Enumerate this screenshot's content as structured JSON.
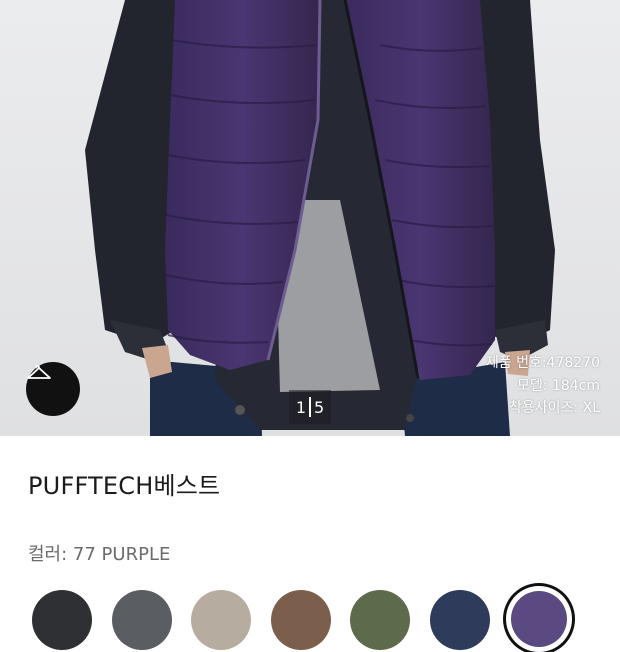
{
  "gallery": {
    "current_page": "1",
    "total_pages": "5",
    "model_info": {
      "product_no_label": "제품 번호:",
      "product_no": "478270",
      "model_label": "모델:",
      "model_height": "184cm",
      "size_label": "착용사이즈:",
      "size": "XL"
    },
    "hanger_icon": "hanger-icon"
  },
  "product": {
    "title": "PUFFTECH베스트",
    "color_label": "컬러:",
    "color_value": "77 PURPLE"
  },
  "swatches": [
    {
      "name": "black",
      "color": "#2f3033"
    },
    {
      "name": "gray",
      "color": "#5a5d61"
    },
    {
      "name": "beige",
      "color": "#b7aca0"
    },
    {
      "name": "brown",
      "color": "#7b5f4c"
    },
    {
      "name": "olive",
      "color": "#5d6a4c"
    },
    {
      "name": "navy",
      "color": "#2e3b5a"
    },
    {
      "name": "purple",
      "color": "#5b4a82",
      "selected": true
    }
  ]
}
